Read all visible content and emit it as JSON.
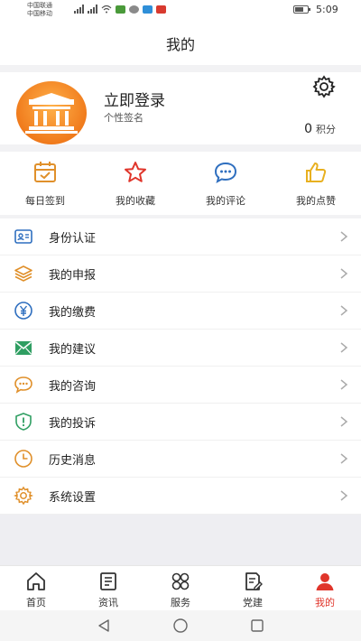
{
  "status_bar": {
    "carrier_1": "中国联通",
    "carrier_2": "中国移动",
    "time": "5:09"
  },
  "header": {
    "title": "我的"
  },
  "profile": {
    "login_label": "立即登录",
    "signature": "个性签名",
    "points_value": "0",
    "points_label": "积分"
  },
  "quick_actions": [
    {
      "label": "每日签到",
      "icon": "calendar-check-icon"
    },
    {
      "label": "我的收藏",
      "icon": "star-icon"
    },
    {
      "label": "我的评论",
      "icon": "comment-icon"
    },
    {
      "label": "我的点赞",
      "icon": "thumbs-up-icon"
    }
  ],
  "menu": [
    {
      "label": "身份认证",
      "icon": "id-card-icon"
    },
    {
      "label": "我的申报",
      "icon": "layers-icon"
    },
    {
      "label": "我的缴费",
      "icon": "yen-coin-icon"
    },
    {
      "label": "我的建议",
      "icon": "mail-icon"
    },
    {
      "label": "我的咨询",
      "icon": "chat-bubble-icon"
    },
    {
      "label": "我的投诉",
      "icon": "shield-alert-icon"
    },
    {
      "label": "历史消息",
      "icon": "clock-icon"
    },
    {
      "label": "系统设置",
      "icon": "settings-icon"
    }
  ],
  "tabs": [
    {
      "label": "首页",
      "icon": "home-icon"
    },
    {
      "label": "资讯",
      "icon": "news-icon"
    },
    {
      "label": "服务",
      "icon": "services-icon"
    },
    {
      "label": "党建",
      "icon": "party-building-icon"
    },
    {
      "label": "我的",
      "icon": "user-icon",
      "active": true
    }
  ],
  "colors": {
    "accent_red": "#e0352b",
    "icon_orange": "#e0902b",
    "icon_green": "#2f9e62",
    "icon_blue": "#2f6fbf",
    "avatar_orange": "#f07b1c"
  }
}
